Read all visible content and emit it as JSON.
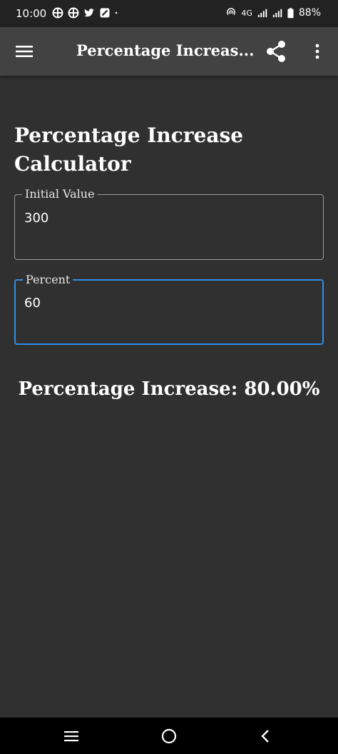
{
  "status_bar": {
    "time": "10:00",
    "network": "4G",
    "battery": "88%",
    "left_icons": [
      "app-icon",
      "app-icon",
      "twitter-icon",
      "app-icon",
      "dot-icon"
    ]
  },
  "app_bar": {
    "title": "Percentage Increas...",
    "menu_icon": "hamburger-menu-icon",
    "share_icon": "share-icon",
    "more_icon": "more-vert-icon"
  },
  "main": {
    "heading": "Percentage Increase Calculator",
    "fields": {
      "initial_value": {
        "label": "Initial Value",
        "value": "300"
      },
      "percent": {
        "label": "Percent",
        "value": "60"
      }
    },
    "result": "Percentage Increase: 80.00%"
  },
  "nav_bar": {
    "recents_icon": "recents-icon",
    "home_icon": "home-icon",
    "back_icon": "back-icon"
  },
  "colors": {
    "background": "#303030",
    "app_bar": "#424242",
    "status_bar": "#222222",
    "focus_accent": "#2f8ee5",
    "text": "#ffffff"
  }
}
